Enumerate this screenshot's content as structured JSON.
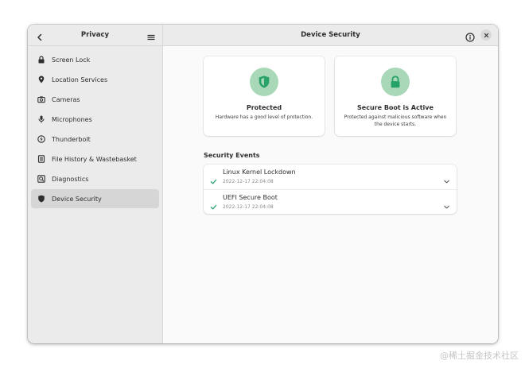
{
  "sidebar": {
    "title": "Privacy",
    "items": [
      {
        "label": "Screen Lock",
        "icon": "lock-icon"
      },
      {
        "label": "Location Services",
        "icon": "location-pin-icon"
      },
      {
        "label": "Cameras",
        "icon": "camera-icon"
      },
      {
        "label": "Microphones",
        "icon": "microphone-icon"
      },
      {
        "label": "Thunderbolt",
        "icon": "thunderbolt-icon"
      },
      {
        "label": "File History & Wastebasket",
        "icon": "file-history-icon"
      },
      {
        "label": "Diagnostics",
        "icon": "diagnostics-icon"
      },
      {
        "label": "Device Security",
        "icon": "shield-icon",
        "active": true
      }
    ]
  },
  "main": {
    "title": "Device Security",
    "cards": [
      {
        "title": "Protected",
        "description": "Hardware has a good level of protection.",
        "icon": "shield-icon"
      },
      {
        "title": "Secure Boot is Active",
        "description": "Protected against malicious software when the device starts.",
        "icon": "padlock-icon"
      }
    ],
    "events_title": "Security Events",
    "events": [
      {
        "name": "Linux Kernel Lockdown",
        "date": "2022-12-17 22:04:08"
      },
      {
        "name": "UEFI Secure Boot",
        "date": "2022-12-17 22:04:08"
      }
    ]
  },
  "watermark": "@稀土掘金技术社区",
  "colors": {
    "accent_green": "#26a269",
    "icon_circle": "#a8d8b7",
    "sidebar_bg": "#ebebeb",
    "active_item": "#d6d6d6"
  }
}
